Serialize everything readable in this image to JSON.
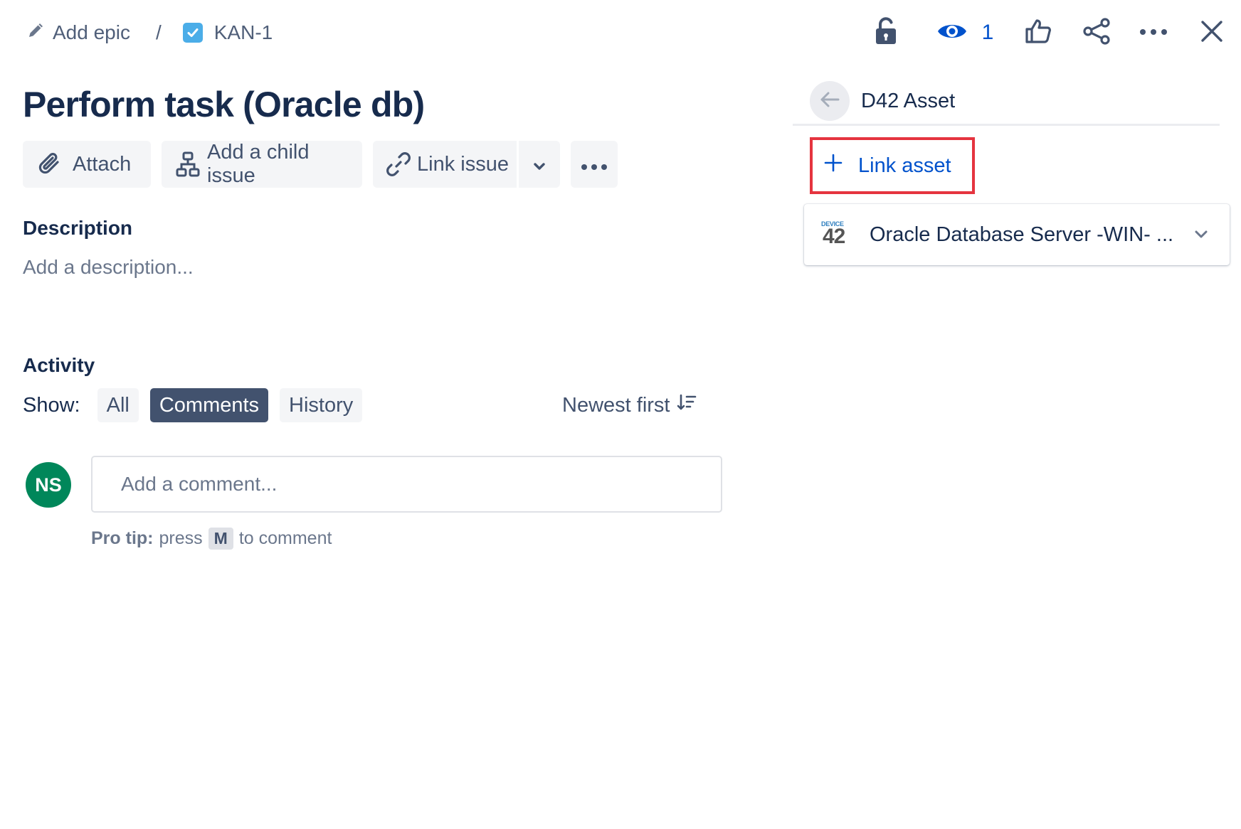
{
  "breadcrumbs": {
    "epic_label": "Add epic",
    "separator": "/",
    "issue_key": "KAN-1"
  },
  "header": {
    "watch_count": "1"
  },
  "issue": {
    "title": "Perform task (Oracle db)"
  },
  "toolbar": {
    "attach": "Attach",
    "add_child": "Add a child issue",
    "link_issue": "Link issue"
  },
  "description": {
    "heading": "Description",
    "placeholder": "Add a description..."
  },
  "activity": {
    "heading": "Activity",
    "show_label": "Show:",
    "filters": [
      "All",
      "Comments",
      "History"
    ],
    "active_filter": "Comments",
    "sort_label": "Newest first"
  },
  "comment": {
    "avatar_initials": "NS",
    "placeholder": "Add a comment...",
    "protip_bold": "Pro tip:",
    "protip_press": "press",
    "protip_key": "M",
    "protip_suffix": "to comment"
  },
  "right_panel": {
    "title": "D42 Asset",
    "link_asset": "Link asset",
    "asset_logo_small": "DEVICE",
    "asset_logo_big": "42",
    "asset_name": "Oracle Database Server -WIN- ..."
  },
  "colors": {
    "primary_text": "#172b4d",
    "secondary_text": "#42526e",
    "link_blue": "#0052cc",
    "avatar_green": "#00875a",
    "highlight_red": "#e5343f",
    "button_bg": "#f4f5f7"
  },
  "icons": [
    "pencil-icon",
    "checkbox-icon",
    "lock-icon",
    "eye-icon",
    "thumbs-up-icon",
    "share-icon",
    "more-icon",
    "close-icon",
    "paperclip-icon",
    "hierarchy-icon",
    "link-icon",
    "chevron-down-icon",
    "sort-icon",
    "arrow-left-icon",
    "plus-icon"
  ]
}
